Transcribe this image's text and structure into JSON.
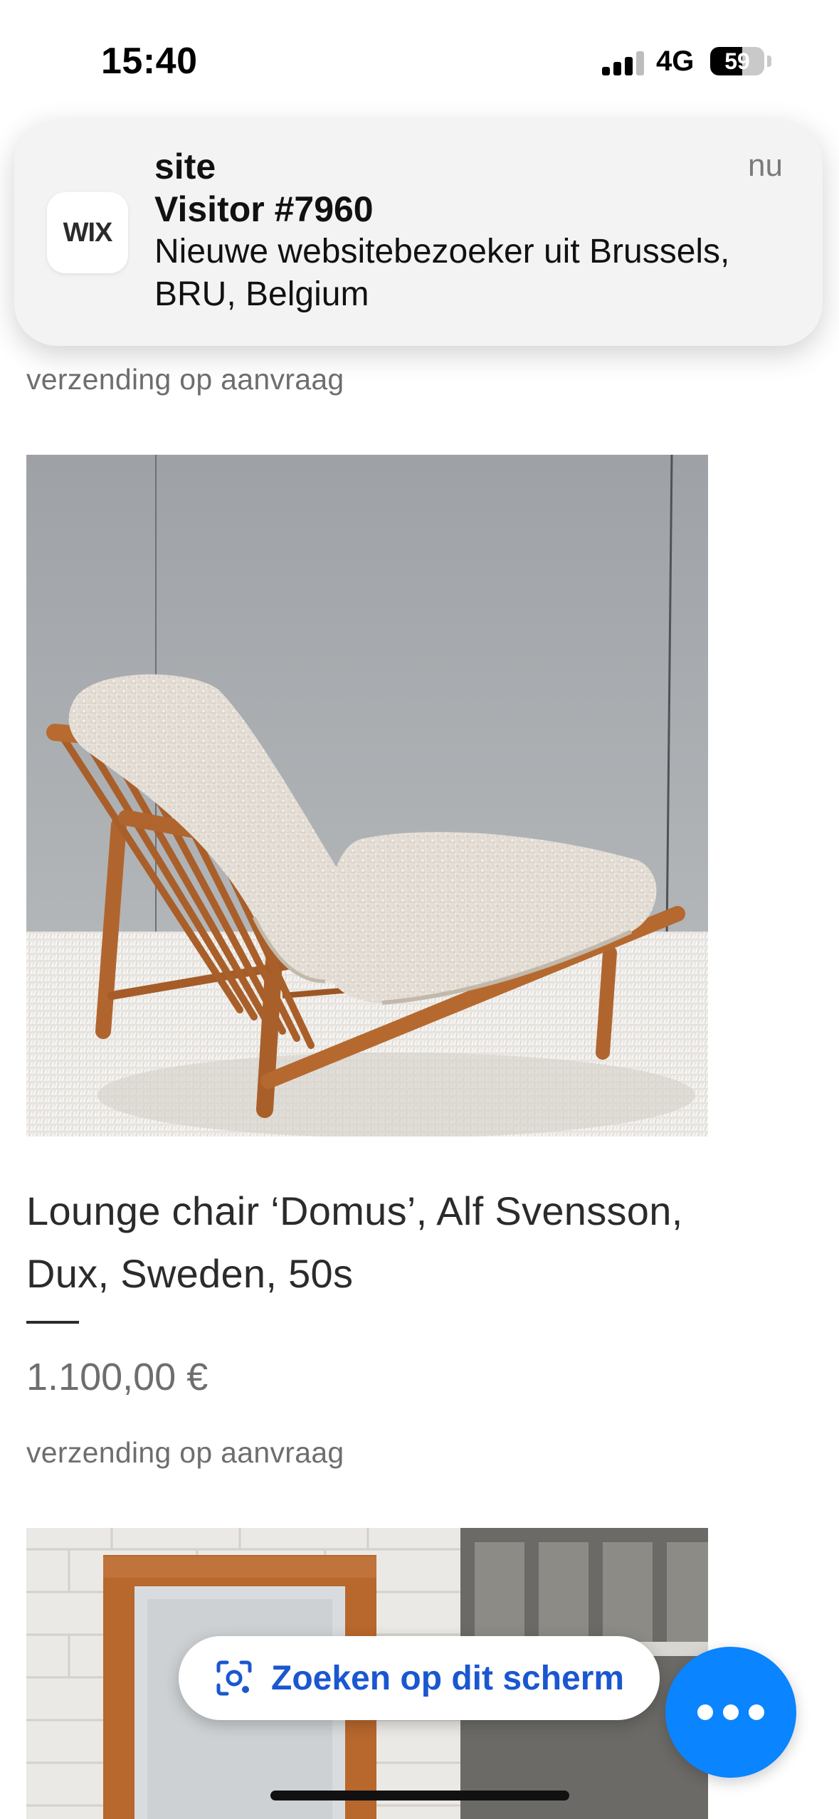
{
  "status_bar": {
    "time": "15:40",
    "network": "4G",
    "battery_level": "59",
    "battery_fraction": 0.59,
    "signal_bars_active": 3,
    "signal_bars_total": 4
  },
  "notification": {
    "app_icon_text": "WIX",
    "title": "site",
    "subtitle": "Visitor #7960",
    "body": "Nieuwe websitebezoeker uit Brussels, BRU, Belgium",
    "time": "nu"
  },
  "page": {
    "top_shipping_note": "verzending op aanvraag",
    "product": {
      "title": "Lounge chair ‘Domus’, Alf Svensson, Dux, Sweden, 50s",
      "price": "1.100,00 €",
      "shipping_note": "verzending op aanvraag"
    }
  },
  "lens": {
    "label": "Zoeken op dit scherm",
    "icon": "lens-icon",
    "color": "#1a57d0"
  },
  "fab": {
    "icon": "more-dots-icon",
    "color": "#0a84ff"
  }
}
